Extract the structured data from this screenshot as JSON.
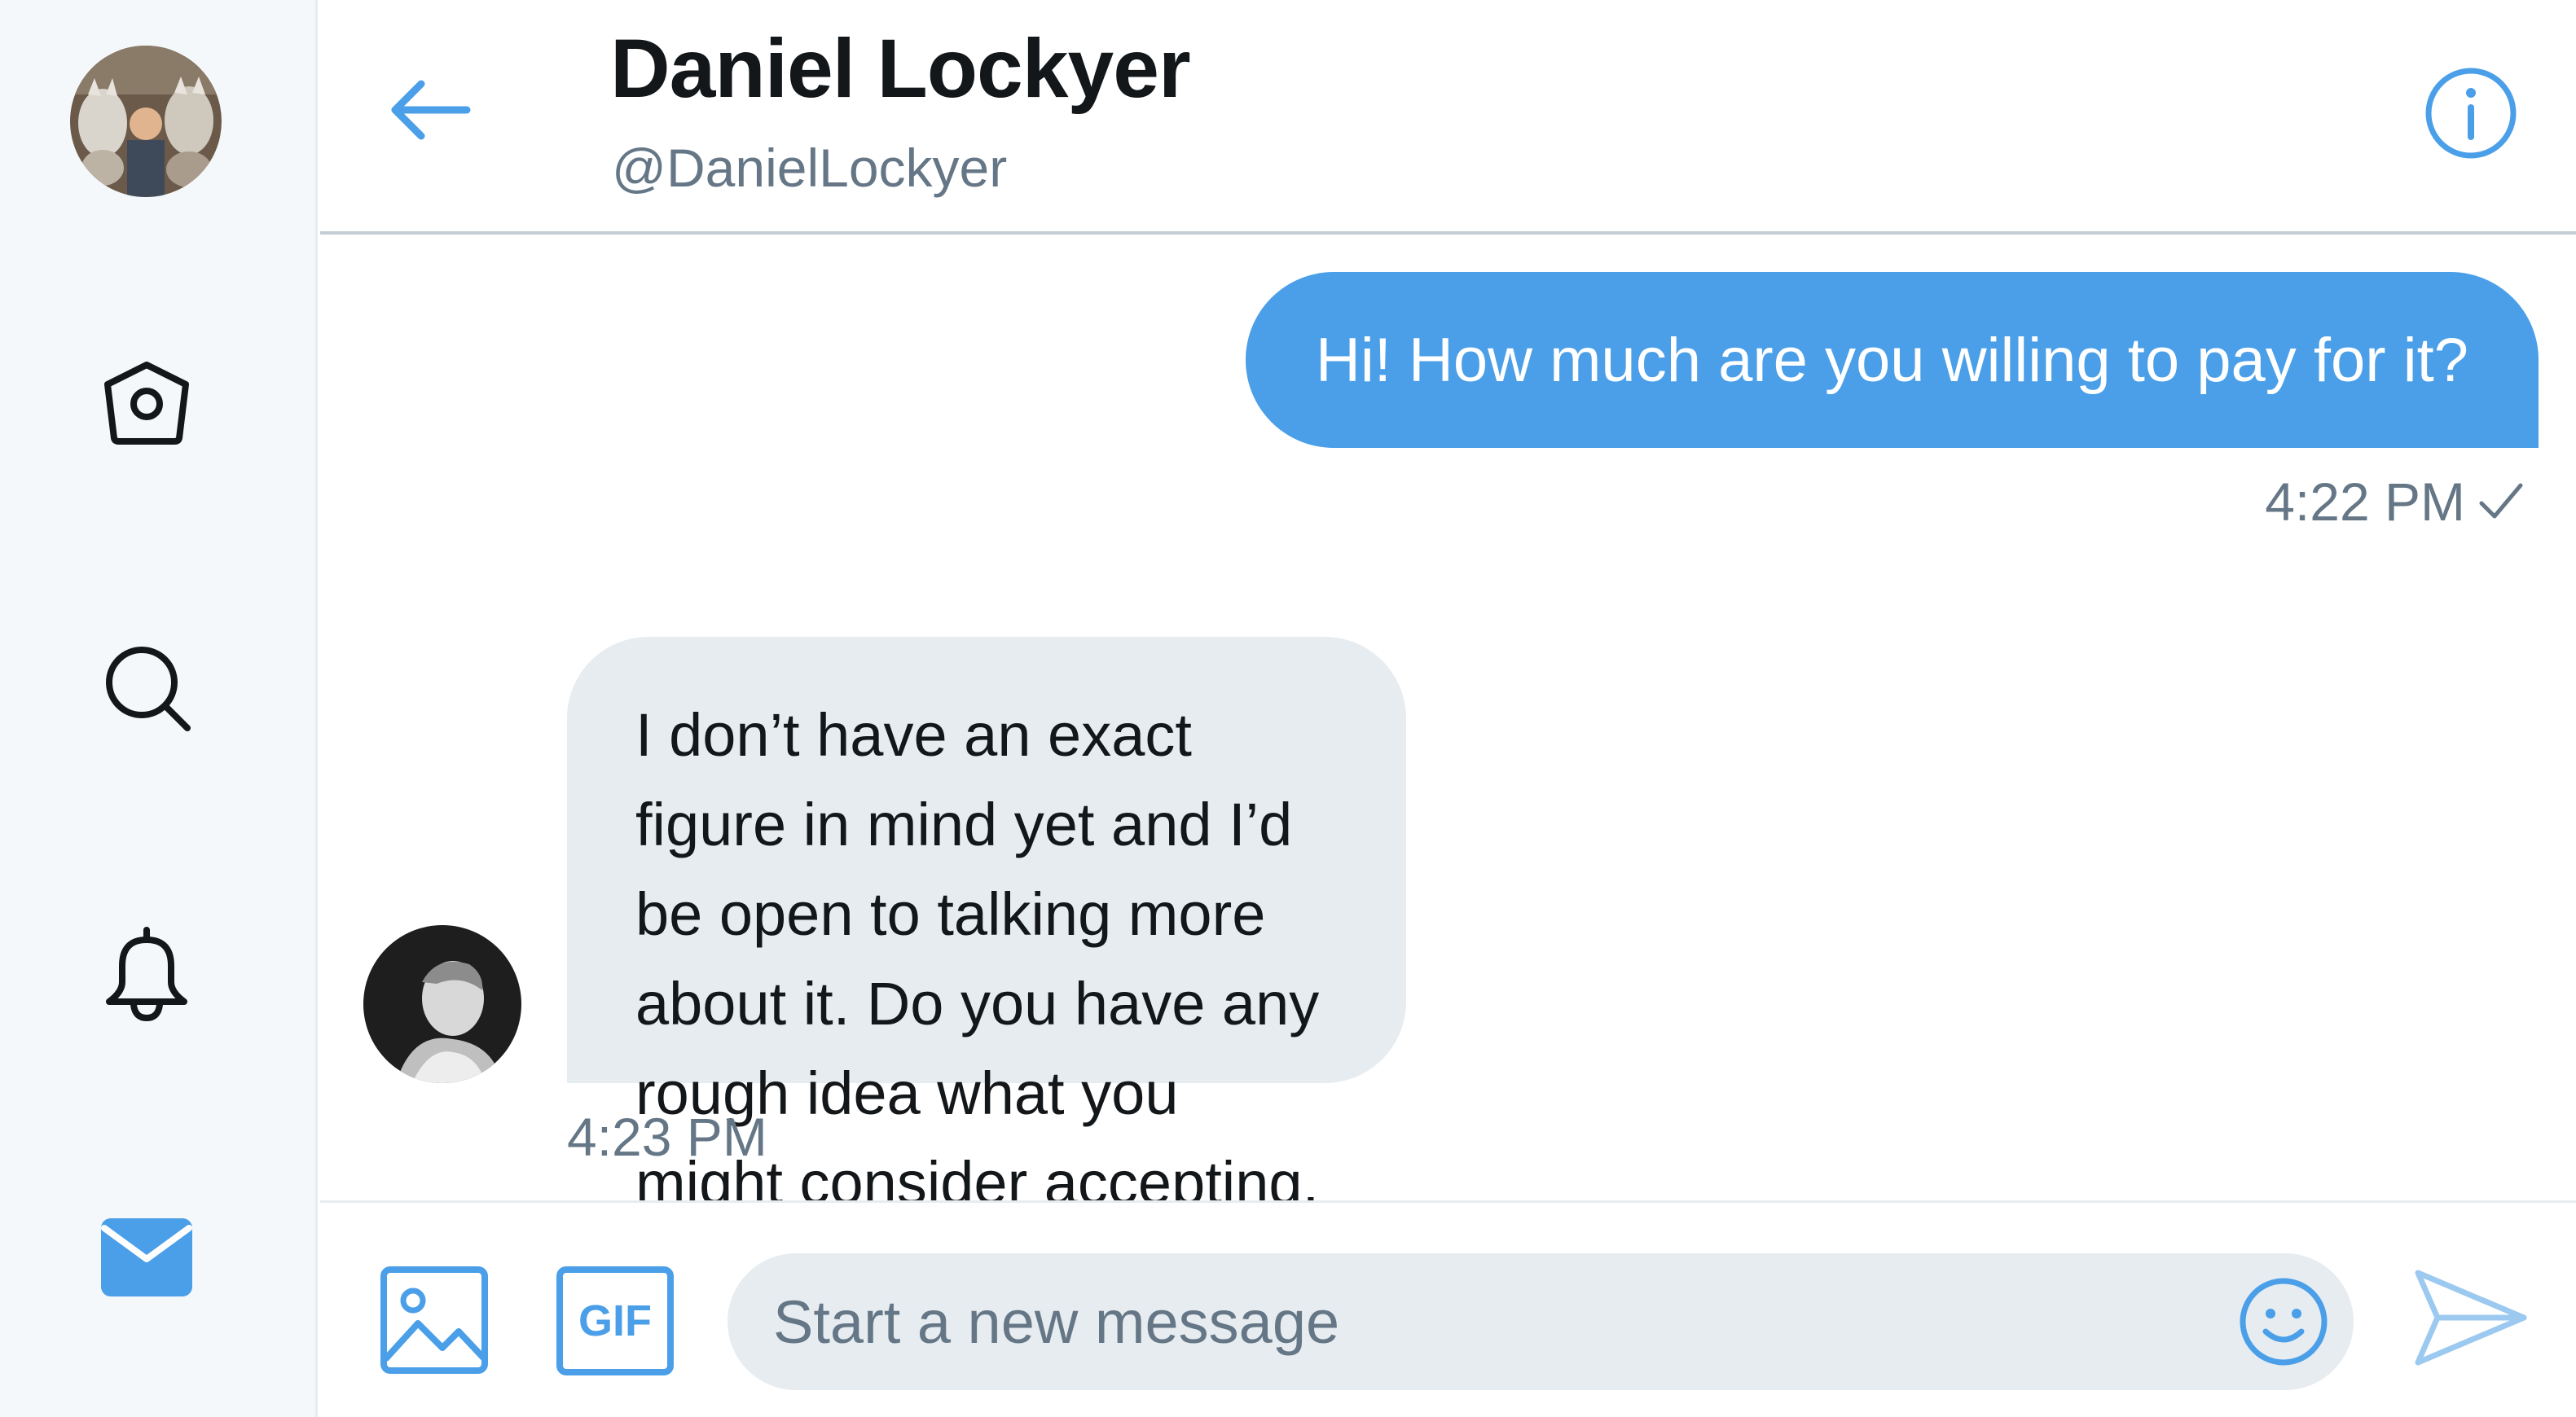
{
  "conversation": {
    "name": "Daniel Lockyer",
    "handle": "@DanielLockyer"
  },
  "sidebar": {
    "items": [
      {
        "icon": "home-icon",
        "label": "Home"
      },
      {
        "icon": "search-icon",
        "label": "Search"
      },
      {
        "icon": "bell-icon",
        "label": "Notifications"
      },
      {
        "icon": "mail-icon",
        "label": "Messages",
        "active": true
      }
    ]
  },
  "messages": [
    {
      "direction": "outgoing",
      "text": "Hi! How much are you willing to pay for it?",
      "time": "4:22 PM",
      "status": "sent-check-icon"
    },
    {
      "direction": "incoming",
      "text": "I don’t have an exact figure in mind yet and I’d be open to talking more about it. Do you have any rough idea what you might consider accepting, how much is current revenue?",
      "time": "4:23 PM"
    }
  ],
  "composer": {
    "gif_label": "GIF",
    "placeholder": "Start a new message",
    "value": ""
  },
  "colors": {
    "accent": "#4a9fe8",
    "bubble_in": "#e6ecf0",
    "sidebar_bg": "#f5f8fa",
    "muted_text": "#657786",
    "primary_text": "#14171a"
  }
}
